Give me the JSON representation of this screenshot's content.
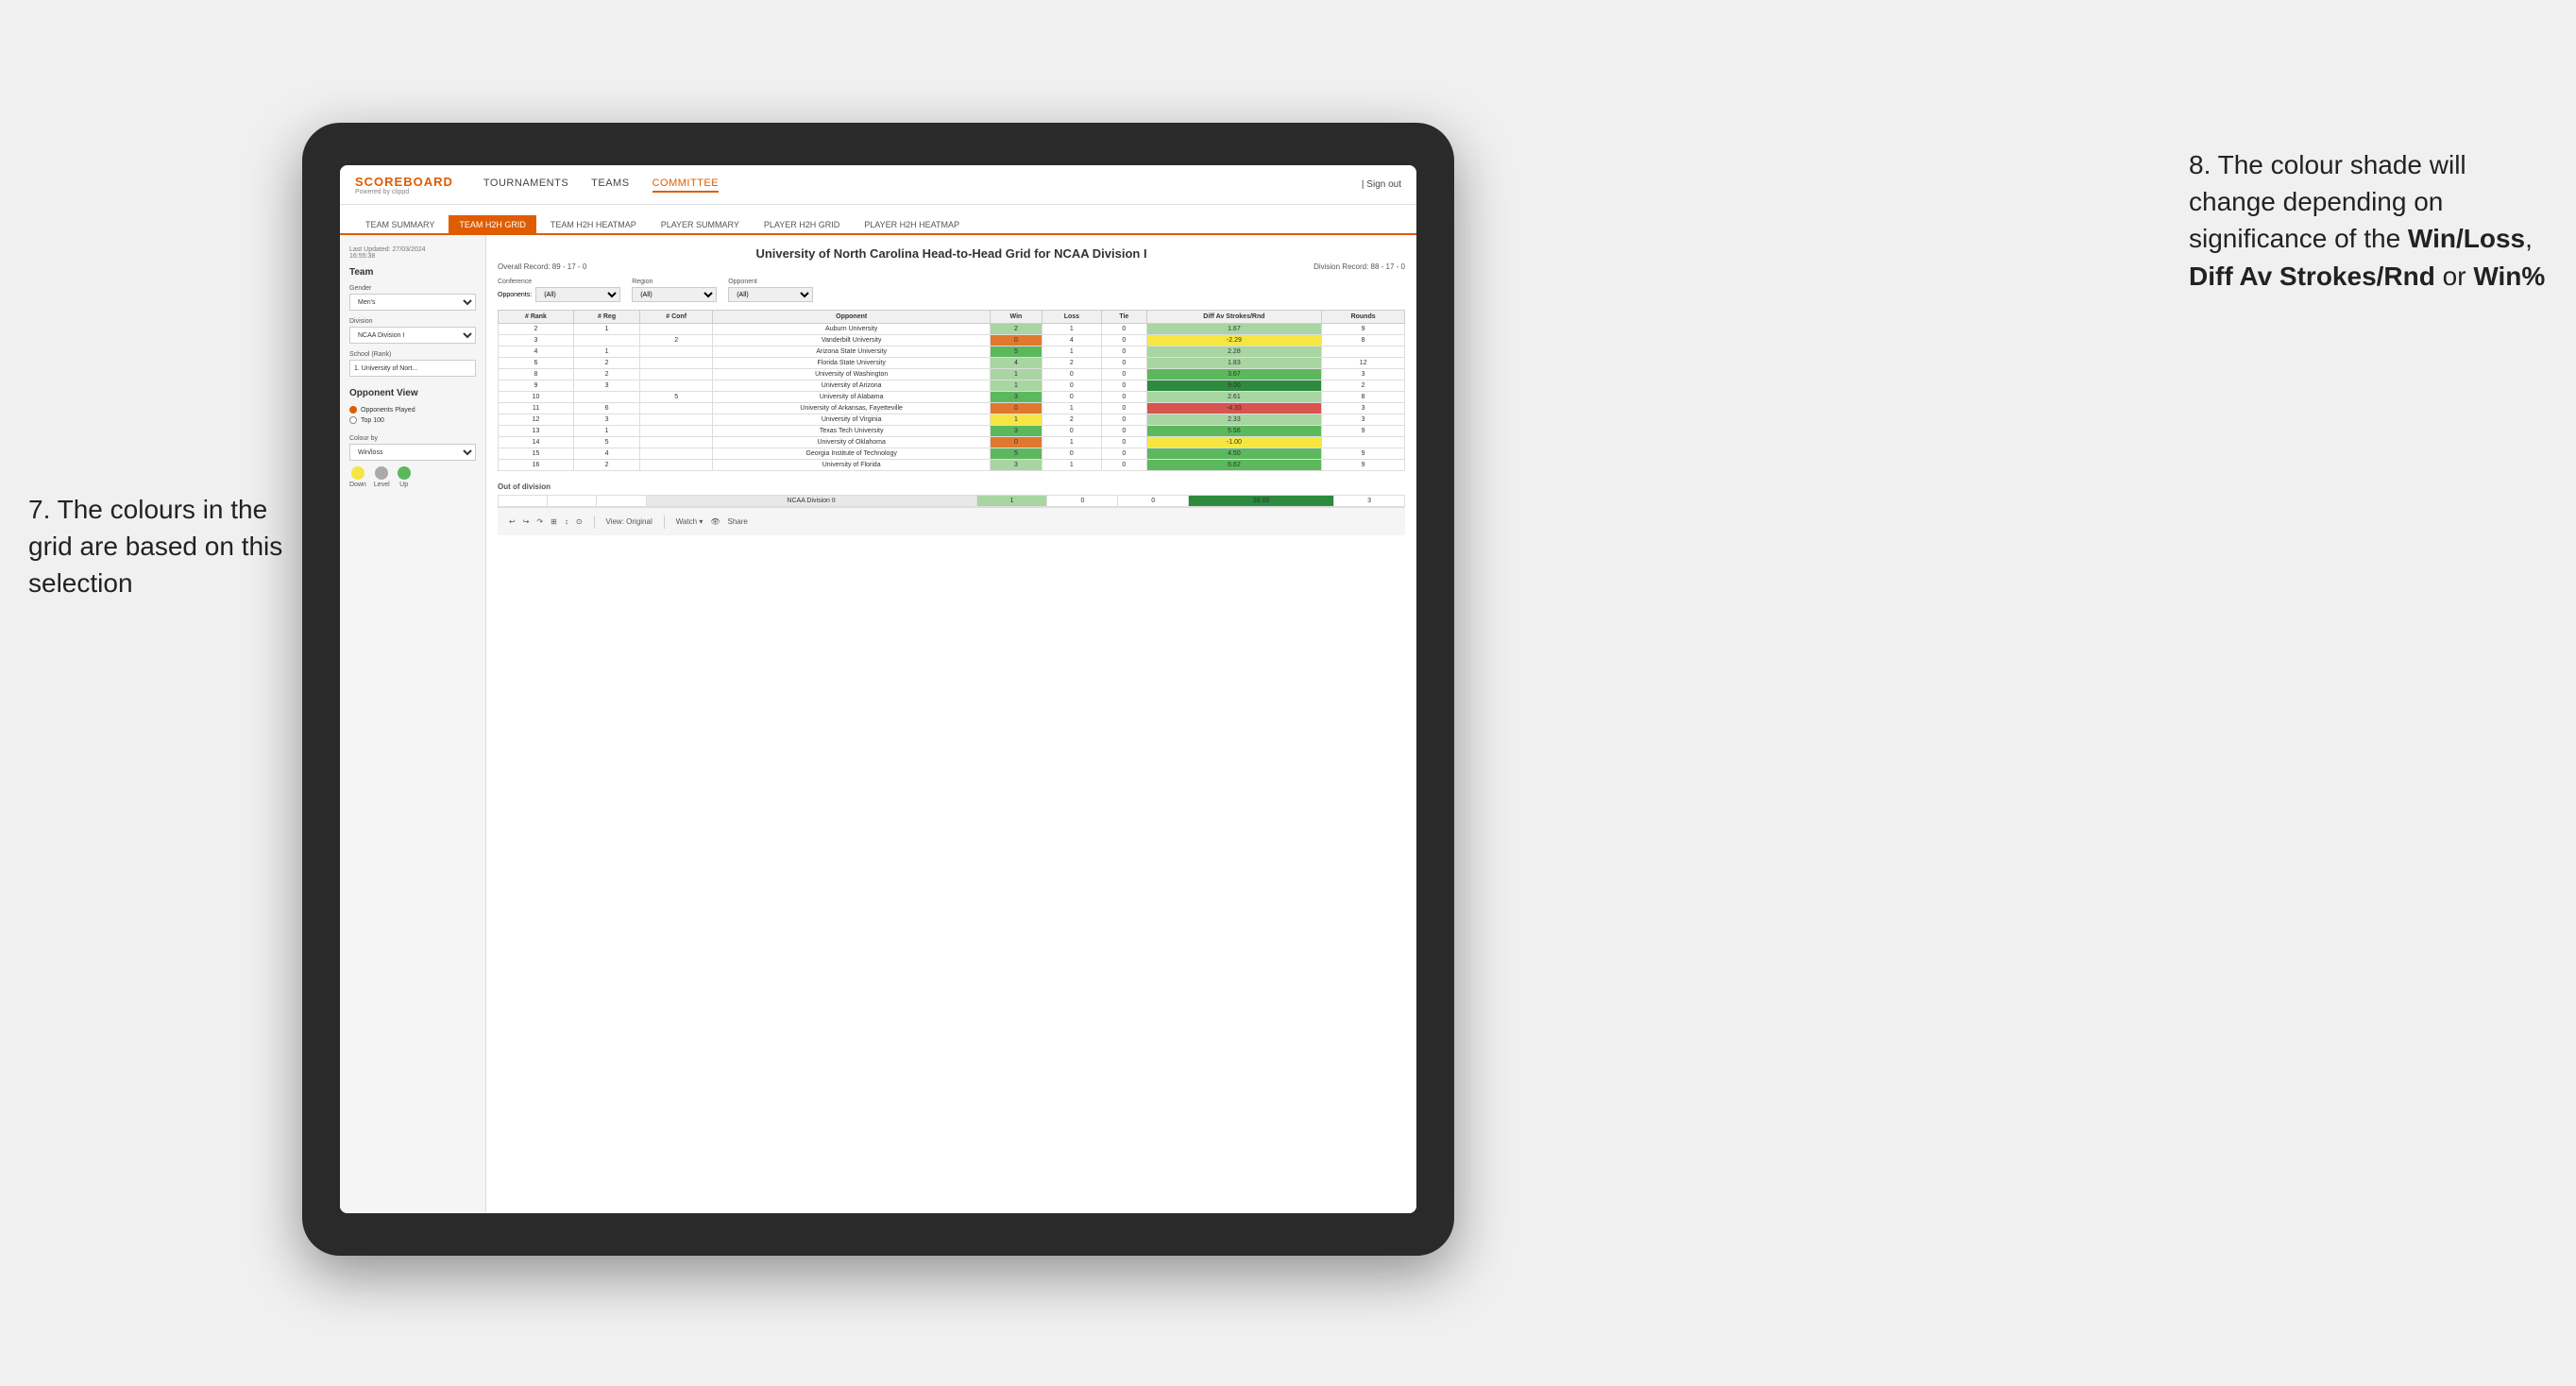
{
  "annotations": {
    "left_title": "7. The colours in the grid are based on this selection",
    "right_title": "8. The colour shade will change depending on significance of the ",
    "right_bold1": "Win/Loss",
    "right_sep1": ", ",
    "right_bold2": "Diff Av Strokes/Rnd",
    "right_sep2": " or ",
    "right_bold3": "Win%"
  },
  "nav": {
    "logo": "SCOREBOARD",
    "logo_sub": "Powered by clippd",
    "items": [
      "TOURNAMENTS",
      "TEAMS",
      "COMMITTEE"
    ],
    "active_item": "COMMITTEE",
    "sign_out": "| Sign out"
  },
  "sub_nav": {
    "items": [
      "TEAM SUMMARY",
      "TEAM H2H GRID",
      "TEAM H2H HEATMAP",
      "PLAYER SUMMARY",
      "PLAYER H2H GRID",
      "PLAYER H2H HEATMAP"
    ],
    "active": "TEAM H2H GRID"
  },
  "left_panel": {
    "last_updated_label": "Last Updated: 27/03/2024",
    "last_updated_time": "16:55:38",
    "team_label": "Team",
    "gender_label": "Gender",
    "gender_value": "Men's",
    "division_label": "Division",
    "division_value": "NCAA Division I",
    "school_label": "School (Rank)",
    "school_value": "1. University of Nort...",
    "opponent_view_label": "Opponent View",
    "radio1": "Opponents Played",
    "radio2": "Top 100",
    "colour_by_label": "Colour by",
    "colour_by_value": "Win/loss",
    "legend": {
      "down_label": "Down",
      "level_label": "Level",
      "up_label": "Up",
      "down_color": "#f5e642",
      "level_color": "#aaaaaa",
      "up_color": "#5cb85c"
    }
  },
  "grid": {
    "title": "University of North Carolina Head-to-Head Grid for NCAA Division I",
    "overall_record": "Overall Record: 89 - 17 - 0",
    "division_record": "Division Record: 88 - 17 - 0",
    "filter_conference_label": "Conference",
    "filter_conference_sublabel": "Opponents:",
    "filter_conference_value": "(All)",
    "filter_region_label": "Region",
    "filter_region_value": "(All)",
    "filter_opponent_label": "Opponent",
    "filter_opponent_value": "(All)",
    "columns": [
      "# Rank",
      "# Reg",
      "# Conf",
      "Opponent",
      "Win",
      "Loss",
      "Tie",
      "Diff Av Strokes/Rnd",
      "Rounds"
    ],
    "rows": [
      {
        "rank": "2",
        "reg": "1",
        "conf": "",
        "opponent": "Auburn University",
        "win": "2",
        "loss": "1",
        "tie": "0",
        "diff": "1.67",
        "rounds": "9",
        "win_color": "cell-green-light",
        "diff_color": "cell-green-light"
      },
      {
        "rank": "3",
        "reg": "",
        "conf": "2",
        "opponent": "Vanderbilt University",
        "win": "0",
        "loss": "4",
        "tie": "0",
        "diff": "-2.29",
        "rounds": "8",
        "win_color": "cell-orange",
        "diff_color": "cell-yellow"
      },
      {
        "rank": "4",
        "reg": "1",
        "conf": "",
        "opponent": "Arizona State University",
        "win": "5",
        "loss": "1",
        "tie": "0",
        "diff": "2.28",
        "rounds": "",
        "win_color": "cell-green-mid",
        "diff_color": "cell-green-light"
      },
      {
        "rank": "6",
        "reg": "2",
        "conf": "",
        "opponent": "Florida State University",
        "win": "4",
        "loss": "2",
        "tie": "0",
        "diff": "1.83",
        "rounds": "12",
        "win_color": "cell-green-light",
        "diff_color": "cell-green-light"
      },
      {
        "rank": "8",
        "reg": "2",
        "conf": "",
        "opponent": "University of Washington",
        "win": "1",
        "loss": "0",
        "tie": "0",
        "diff": "3.67",
        "rounds": "3",
        "win_color": "cell-green-light",
        "diff_color": "cell-green-mid"
      },
      {
        "rank": "9",
        "reg": "3",
        "conf": "",
        "opponent": "University of Arizona",
        "win": "1",
        "loss": "0",
        "tie": "0",
        "diff": "9.00",
        "rounds": "2",
        "win_color": "cell-green-light",
        "diff_color": "cell-green-dark"
      },
      {
        "rank": "10",
        "reg": "",
        "conf": "5",
        "opponent": "University of Alabama",
        "win": "3",
        "loss": "0",
        "tie": "0",
        "diff": "2.61",
        "rounds": "8",
        "win_color": "cell-green-mid",
        "diff_color": "cell-green-light"
      },
      {
        "rank": "11",
        "reg": "6",
        "conf": "",
        "opponent": "University of Arkansas, Fayetteville",
        "win": "0",
        "loss": "1",
        "tie": "0",
        "diff": "-4.33",
        "rounds": "3",
        "win_color": "cell-orange",
        "diff_color": "cell-red"
      },
      {
        "rank": "12",
        "reg": "3",
        "conf": "",
        "opponent": "University of Virginia",
        "win": "1",
        "loss": "2",
        "tie": "0",
        "diff": "2.33",
        "rounds": "3",
        "win_color": "cell-yellow",
        "diff_color": "cell-green-light"
      },
      {
        "rank": "13",
        "reg": "1",
        "conf": "",
        "opponent": "Texas Tech University",
        "win": "3",
        "loss": "0",
        "tie": "0",
        "diff": "5.56",
        "rounds": "9",
        "win_color": "cell-green-mid",
        "diff_color": "cell-green-mid"
      },
      {
        "rank": "14",
        "reg": "5",
        "conf": "",
        "opponent": "University of Oklahoma",
        "win": "0",
        "loss": "1",
        "tie": "0",
        "diff": "-1.00",
        "rounds": "",
        "win_color": "cell-orange",
        "diff_color": "cell-yellow"
      },
      {
        "rank": "15",
        "reg": "4",
        "conf": "",
        "opponent": "Georgia Institute of Technology",
        "win": "5",
        "loss": "0",
        "tie": "0",
        "diff": "4.50",
        "rounds": "9",
        "win_color": "cell-green-mid",
        "diff_color": "cell-green-mid"
      },
      {
        "rank": "16",
        "reg": "2",
        "conf": "",
        "opponent": "University of Florida",
        "win": "3",
        "loss": "1",
        "tie": "0",
        "diff": "6.62",
        "rounds": "9",
        "win_color": "cell-green-light",
        "diff_color": "cell-green-mid"
      }
    ],
    "out_of_division_label": "Out of division",
    "out_row": {
      "division": "NCAA Division II",
      "win": "1",
      "loss": "0",
      "tie": "0",
      "diff": "26.00",
      "rounds": "3",
      "win_color": "cell-green-light",
      "diff_color": "cell-green-dark"
    }
  },
  "toolbar": {
    "view_label": "View: Original",
    "watch_label": "Watch ▾",
    "share_label": "Share"
  }
}
